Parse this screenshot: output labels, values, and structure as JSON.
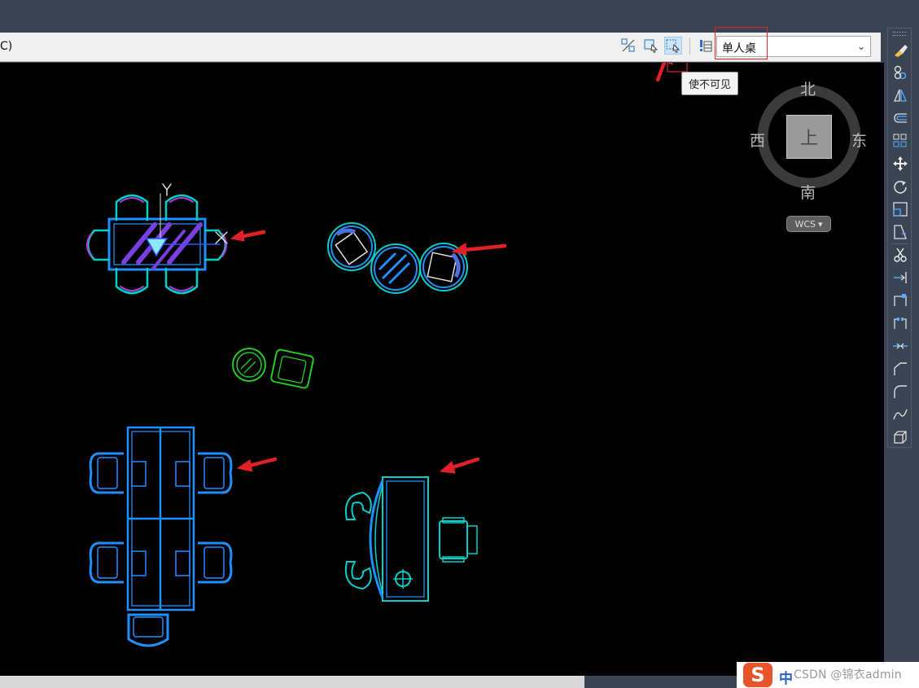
{
  "block_toolbar": {
    "left_text": "C)",
    "buttons": [
      {
        "name": "make-visible",
        "icon": "visibility-toggle-icon"
      },
      {
        "name": "make-visible-select",
        "icon": "block-select-icon"
      },
      {
        "name": "make-invisible",
        "icon": "block-invisible-icon"
      }
    ],
    "block_table_icon": "block-table-icon",
    "visibility_state_value": "单人桌",
    "tooltip": "使不可见"
  },
  "viewcube": {
    "north": "北",
    "south": "南",
    "east": "东",
    "west": "西",
    "face": "上",
    "wcs_label": "WCS",
    "wcs_caret": "▾"
  },
  "ucs": {
    "y_label": "Y"
  },
  "right_toolbar": {
    "tools": [
      "erase-icon",
      "copy-icon",
      "mirror-icon",
      "offset-icon",
      "array-icon",
      "move-icon",
      "rotate-icon",
      "scale-icon",
      "stretch-icon",
      "trim-icon",
      "extend-icon",
      "break-at-point-icon",
      "break-icon",
      "join-icon",
      "chamfer-icon",
      "fillet-icon",
      "blend-curves-icon",
      "explode-icon"
    ]
  },
  "taskbar": {
    "ime_logo": "S",
    "ime_mode": "中",
    "watermark": "CSDN @锦衣admin"
  },
  "colors": {
    "canvas": "#000000",
    "annotation_red": "#e0212a",
    "cad_cyan": "#00d0c8",
    "cad_blue": "#1e90ff",
    "cad_green": "#22cc22",
    "cad_purple": "#7a3fe0"
  }
}
